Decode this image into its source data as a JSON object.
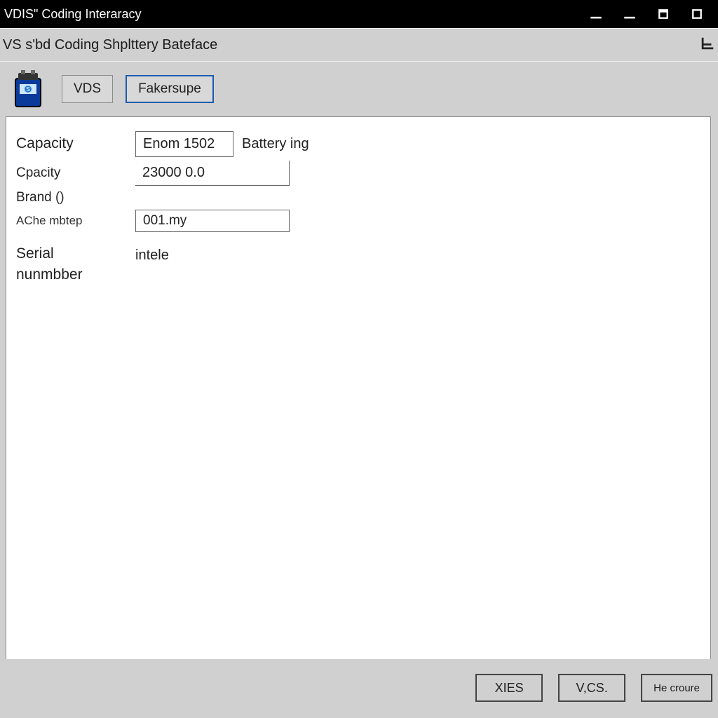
{
  "titlebar": {
    "title": "VDIS\" Coding Interaracy"
  },
  "subbar": {
    "title": "VS s'bd Coding Shplttery Bateface"
  },
  "toolbar": {
    "btn1": "VDS",
    "btn2": "Fakersupe"
  },
  "form": {
    "row1": {
      "label": "Capacity",
      "value": "Enom 1502",
      "suffix": "Battery ing"
    },
    "row2": {
      "label": "Cpacity",
      "value": "23000 0.0"
    },
    "row3": {
      "label": "Brand ()"
    },
    "row4": {
      "label": "AChe mbtep",
      "value": "001.my"
    },
    "serial": {
      "label": "Serial\nnunmbber",
      "value": "intele"
    }
  },
  "footer": {
    "btn1": "XIES",
    "btn2": "V,CS.",
    "btn3": "He croure"
  }
}
